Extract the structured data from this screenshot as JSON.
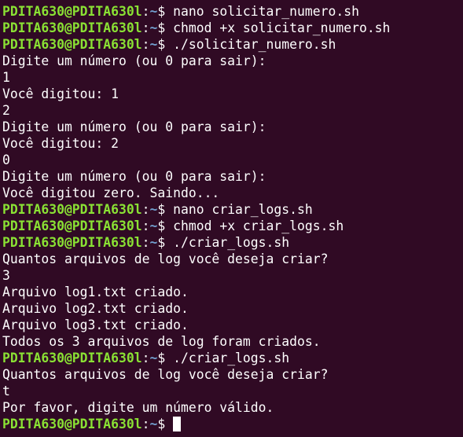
{
  "colors": {
    "background": "#300a24",
    "text": "#ffffff",
    "prompt_user": "#8ae234",
    "prompt_path": "#729fcf"
  },
  "prompt": {
    "user_host": "PDITA630@PDITA630l",
    "separator": ":",
    "path": "~",
    "symbol": "$"
  },
  "lines": [
    {
      "type": "prompt",
      "command": " nano solicitar_numero.sh"
    },
    {
      "type": "prompt",
      "command": " chmod +x solicitar_numero.sh"
    },
    {
      "type": "prompt",
      "command": " ./solicitar_numero.sh"
    },
    {
      "type": "output",
      "text": "Digite um número (ou 0 para sair):"
    },
    {
      "type": "output",
      "text": "1"
    },
    {
      "type": "output",
      "text": "Você digitou: 1"
    },
    {
      "type": "output",
      "text": "2"
    },
    {
      "type": "output",
      "text": "Digite um número (ou 0 para sair):"
    },
    {
      "type": "output",
      "text": "Você digitou: 2"
    },
    {
      "type": "output",
      "text": "0"
    },
    {
      "type": "output",
      "text": "Digite um número (ou 0 para sair):"
    },
    {
      "type": "output",
      "text": "Você digitou zero. Saindo..."
    },
    {
      "type": "prompt",
      "command": " nano criar_logs.sh"
    },
    {
      "type": "prompt",
      "command": " chmod +x criar_logs.sh"
    },
    {
      "type": "prompt",
      "command": " ./criar_logs.sh"
    },
    {
      "type": "output",
      "text": "Quantos arquivos de log você deseja criar?"
    },
    {
      "type": "output",
      "text": "3"
    },
    {
      "type": "output",
      "text": "Arquivo log1.txt criado."
    },
    {
      "type": "output",
      "text": "Arquivo log2.txt criado."
    },
    {
      "type": "output",
      "text": "Arquivo log3.txt criado."
    },
    {
      "type": "output",
      "text": "Todos os 3 arquivos de log foram criados."
    },
    {
      "type": "prompt",
      "command": " ./criar_logs.sh"
    },
    {
      "type": "output",
      "text": "Quantos arquivos de log você deseja criar?"
    },
    {
      "type": "output",
      "text": "t"
    },
    {
      "type": "output",
      "text": "Por favor, digite um número válido."
    },
    {
      "type": "prompt",
      "command": " ",
      "cursor": true
    }
  ]
}
